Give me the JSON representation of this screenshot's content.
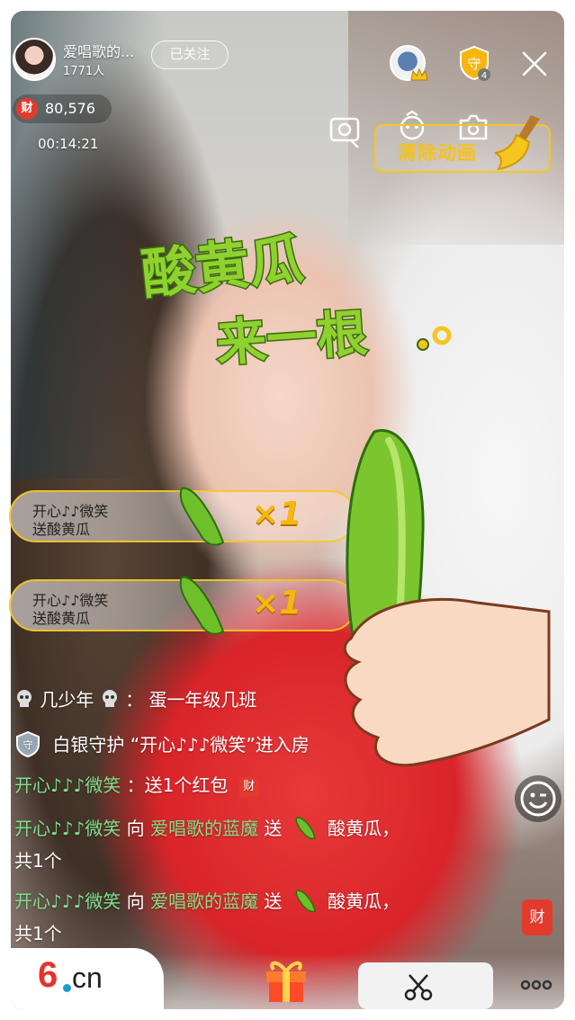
{
  "host": {
    "name": "爱唱歌的...",
    "fans": "1771人",
    "follow_label": "已关注"
  },
  "wealth": {
    "badge": "财",
    "value": "80,576"
  },
  "timer": "00:14:21",
  "guard": {
    "badge": "守",
    "count": "4"
  },
  "clear_animation_label": "清除动画",
  "animation": {
    "line1": "酸黄瓜",
    "line2": "来一根",
    "accent_color": "#7ec425"
  },
  "toasts": [
    {
      "user": "开心♪♪微笑",
      "action": "送酸黄瓜",
      "multiplier": "×1"
    },
    {
      "user": "开心♪♪微笑",
      "action": "送酸黄瓜",
      "multiplier": "×1"
    }
  ],
  "chat": {
    "line1": {
      "user": "几少年",
      "text": "蛋一年级几班"
    },
    "line2": {
      "prefix": "守",
      "text": "白银守护 “开心♪♪♪微笑”进入房"
    },
    "line3": {
      "user": "开心♪♪♪微笑",
      "text": "：送1个红包",
      "badge": "财"
    },
    "line4": {
      "user": "开心♪♪♪微笑",
      "verb": "向",
      "target": "爱唱歌的蓝魔",
      "send": "送",
      "gift": "酸黄瓜，",
      "total": "共1个"
    },
    "line5": {
      "user": "开心♪♪♪微笑",
      "verb": "向",
      "target": "爱唱歌的蓝魔",
      "send": "送",
      "gift": "酸黄瓜，",
      "total": "共1个"
    }
  },
  "side_badge": "财",
  "logo": {
    "six": "6",
    "cn": "cn"
  },
  "colors": {
    "brand_red": "#e8302a",
    "gold": "#f7c520",
    "chat_green": "#7fe08a"
  }
}
